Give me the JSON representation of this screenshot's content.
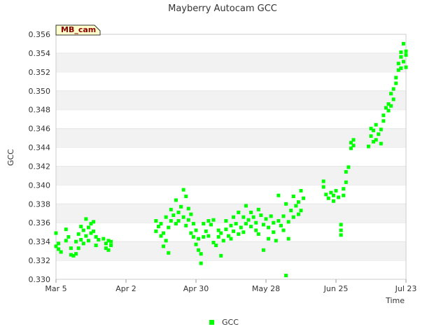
{
  "chart_data": {
    "type": "scatter",
    "title": "Mayberry Autocam GCC",
    "xlabel": "Time",
    "ylabel": "GCC",
    "badge": "MB_cam",
    "x_ticks": [
      "Mar 5",
      "Apr 2",
      "Apr 30",
      "May 28",
      "Jun 25",
      "Jul 23"
    ],
    "x_range": [
      "Mar 5",
      "Jul 23"
    ],
    "ylim": [
      0.33,
      0.356
    ],
    "y_ticks": [
      "0.330",
      "0.332",
      "0.334",
      "0.336",
      "0.338",
      "0.340",
      "0.342",
      "0.344",
      "0.346",
      "0.348",
      "0.350",
      "0.352",
      "0.354",
      "0.356"
    ],
    "grid": "horizontal alternating bands",
    "legend": {
      "position": "bottom",
      "entries": [
        "GCC"
      ]
    },
    "colors": {
      "series": "#00ff00",
      "band": "#f2f2f2",
      "badge_fill": "#ffffcc"
    },
    "series": [
      {
        "name": "GCC",
        "points": [
          [
            "Mar 5",
            0.3335
          ],
          [
            "Mar 5",
            0.3349
          ],
          [
            "Mar 6",
            0.3332
          ],
          [
            "Mar 6",
            0.3338
          ],
          [
            "Mar 7",
            0.3329
          ],
          [
            "Mar 9",
            0.3341
          ],
          [
            "Mar 9",
            0.3353
          ],
          [
            "Mar 10",
            0.3345
          ],
          [
            "Mar 11",
            0.3326
          ],
          [
            "Mar 11",
            0.3333
          ],
          [
            "Mar 12",
            0.3325
          ],
          [
            "Mar 13",
            0.334
          ],
          [
            "Mar 13",
            0.3327
          ],
          [
            "Mar 14",
            0.3348
          ],
          [
            "Mar 14",
            0.3333
          ],
          [
            "Mar 15",
            0.3356
          ],
          [
            "Mar 15",
            0.3342
          ],
          [
            "Mar 16",
            0.3338
          ],
          [
            "Mar 16",
            0.3352
          ],
          [
            "Mar 17",
            0.3364
          ],
          [
            "Mar 17",
            0.3346
          ],
          [
            "Mar 18",
            0.3355
          ],
          [
            "Mar 18",
            0.3341
          ],
          [
            "Mar 19",
            0.3359
          ],
          [
            "Mar 19",
            0.3349
          ],
          [
            "Mar 20",
            0.3351
          ],
          [
            "Mar 20",
            0.3361
          ],
          [
            "Mar 21",
            0.3345
          ],
          [
            "Mar 21",
            0.3336
          ],
          [
            "Mar 22",
            0.3342
          ],
          [
            "Mar 24",
            0.3343
          ],
          [
            "Mar 25",
            0.3338
          ],
          [
            "Mar 25",
            0.3333
          ],
          [
            "Mar 26",
            0.3341
          ],
          [
            "Mar 26",
            0.3331
          ],
          [
            "Mar 27",
            0.3336
          ],
          [
            "Mar 27",
            0.334
          ],
          [
            "Apr 14",
            0.3362
          ],
          [
            "Apr 14",
            0.3351
          ],
          [
            "Apr 15",
            0.3356
          ],
          [
            "Apr 16",
            0.3346
          ],
          [
            "Apr 16",
            0.3359
          ],
          [
            "Apr 17",
            0.3335
          ],
          [
            "Apr 17",
            0.3349
          ],
          [
            "Apr 18",
            0.3366
          ],
          [
            "Apr 18",
            0.3341
          ],
          [
            "Apr 19",
            0.3328
          ],
          [
            "Apr 19",
            0.3355
          ],
          [
            "Apr 20",
            0.3374
          ],
          [
            "Apr 20",
            0.3362
          ],
          [
            "Apr 21",
            0.3368
          ],
          [
            "Apr 22",
            0.3359
          ],
          [
            "Apr 22",
            0.3384
          ],
          [
            "Apr 23",
            0.3371
          ],
          [
            "Apr 23",
            0.3362
          ],
          [
            "Apr 24",
            0.3377
          ],
          [
            "Apr 25",
            0.3395
          ],
          [
            "Apr 25",
            0.3366
          ],
          [
            "Apr 26",
            0.3388
          ],
          [
            "Apr 26",
            0.3357
          ],
          [
            "Apr 27",
            0.3375
          ],
          [
            "Apr 27",
            0.3363
          ],
          [
            "Apr 28",
            0.3349
          ],
          [
            "Apr 28",
            0.3369
          ],
          [
            "Apr 29",
            0.3359
          ],
          [
            "Apr 29",
            0.3345
          ],
          [
            "Apr 30",
            0.3337
          ],
          [
            "Apr 30",
            0.3352
          ],
          [
            "May 1",
            0.3331
          ],
          [
            "May 1",
            0.3343
          ],
          [
            "May 2",
            0.3327
          ],
          [
            "May 2",
            0.3317
          ],
          [
            "May 3",
            0.3359
          ],
          [
            "May 3",
            0.3345
          ],
          [
            "May 4",
            0.3351
          ],
          [
            "May 5",
            0.3362
          ],
          [
            "May 5",
            0.3346
          ],
          [
            "May 6",
            0.3358
          ],
          [
            "May 7",
            0.3363
          ],
          [
            "May 7",
            0.3339
          ],
          [
            "May 8",
            0.3336
          ],
          [
            "May 9",
            0.3352
          ],
          [
            "May 9",
            0.3345
          ],
          [
            "May 10",
            0.3325
          ],
          [
            "May 10",
            0.3349
          ],
          [
            "May 11",
            0.3341
          ],
          [
            "May 12",
            0.3362
          ],
          [
            "May 12",
            0.3353
          ],
          [
            "May 13",
            0.3346
          ],
          [
            "May 14",
            0.3357
          ],
          [
            "May 14",
            0.3343
          ],
          [
            "May 15",
            0.3366
          ],
          [
            "May 15",
            0.3351
          ],
          [
            "May 16",
            0.3359
          ],
          [
            "May 17",
            0.3348
          ],
          [
            "May 17",
            0.3371
          ],
          [
            "May 18",
            0.3355
          ],
          [
            "May 19",
            0.3366
          ],
          [
            "May 19",
            0.335
          ],
          [
            "May 20",
            0.3378
          ],
          [
            "May 20",
            0.3359
          ],
          [
            "May 21",
            0.3363
          ],
          [
            "May 22",
            0.3356
          ],
          [
            "May 22",
            0.3371
          ],
          [
            "May 23",
            0.3366
          ],
          [
            "May 24",
            0.3352
          ],
          [
            "May 24",
            0.336
          ],
          [
            "May 25",
            0.3374
          ],
          [
            "May 25",
            0.3348
          ],
          [
            "May 26",
            0.3368
          ],
          [
            "May 27",
            0.3358
          ],
          [
            "May 27",
            0.3331
          ],
          [
            "May 28",
            0.3364
          ],
          [
            "May 29",
            0.3355
          ],
          [
            "May 29",
            0.3343
          ],
          [
            "May 30",
            0.3367
          ],
          [
            "May 31",
            0.335
          ],
          [
            "May 31",
            0.336
          ],
          [
            "Jun 1",
            0.3341
          ],
          [
            "Jun 2",
            0.3389
          ],
          [
            "Jun 2",
            0.3362
          ],
          [
            "Jun 3",
            0.3357
          ],
          [
            "Jun 4",
            0.3367
          ],
          [
            "Jun 4",
            0.3352
          ],
          [
            "Jun 5",
            0.338
          ],
          [
            "Jun 5",
            0.3304
          ],
          [
            "Jun 6",
            0.3361
          ],
          [
            "Jun 6",
            0.3343
          ],
          [
            "Jun 7",
            0.3373
          ],
          [
            "Jun 8",
            0.3388
          ],
          [
            "Jun 8",
            0.3366
          ],
          [
            "Jun 9",
            0.3378
          ],
          [
            "Jun 10",
            0.3369
          ],
          [
            "Jun 10",
            0.3382
          ],
          [
            "Jun 11",
            0.3394
          ],
          [
            "Jun 11",
            0.3373
          ],
          [
            "Jun 12",
            0.3386
          ],
          [
            "Jun 20",
            0.3404
          ],
          [
            "Jun 20",
            0.3398
          ],
          [
            "Jun 21",
            0.339
          ],
          [
            "Jun 22",
            0.3386
          ],
          [
            "Jun 23",
            0.3392
          ],
          [
            "Jun 24",
            0.3383
          ],
          [
            "Jun 24",
            0.3389
          ],
          [
            "Jun 25",
            0.3394
          ],
          [
            "Jun 26",
            0.3387
          ],
          [
            "Jun 27",
            0.3352
          ],
          [
            "Jun 27",
            0.3358
          ],
          [
            "Jun 27",
            0.3347
          ],
          [
            "Jun 28",
            0.3396
          ],
          [
            "Jun 28",
            0.3389
          ],
          [
            "Jun 29",
            0.3403
          ],
          [
            "Jun 29",
            0.3414
          ],
          [
            "Jun 30",
            0.3419
          ],
          [
            "Jul 1",
            0.3439
          ],
          [
            "Jul 1",
            0.3445
          ],
          [
            "Jul 2",
            0.3448
          ],
          [
            "Jul 2",
            0.3442
          ],
          [
            "Jul 8",
            0.3441
          ],
          [
            "Jul 9",
            0.3452
          ],
          [
            "Jul 9",
            0.346
          ],
          [
            "Jul 10",
            0.3446
          ],
          [
            "Jul 10",
            0.3458
          ],
          [
            "Jul 11",
            0.3448
          ],
          [
            "Jul 11",
            0.3464
          ],
          [
            "Jul 12",
            0.3454
          ],
          [
            "Jul 13",
            0.3459
          ],
          [
            "Jul 13",
            0.3444
          ],
          [
            "Jul 14",
            0.3468
          ],
          [
            "Jul 14",
            0.3474
          ],
          [
            "Jul 15",
            0.3482
          ],
          [
            "Jul 16",
            0.3486
          ],
          [
            "Jul 16",
            0.3479
          ],
          [
            "Jul 17",
            0.3497
          ],
          [
            "Jul 17",
            0.3484
          ],
          [
            "Jul 18",
            0.3491
          ],
          [
            "Jul 18",
            0.3502
          ],
          [
            "Jul 19",
            0.3508
          ],
          [
            "Jul 19",
            0.3514
          ],
          [
            "Jul 20",
            0.3522
          ],
          [
            "Jul 20",
            0.3529
          ],
          [
            "Jul 21",
            0.3536
          ],
          [
            "Jul 21",
            0.3541
          ],
          [
            "Jul 21",
            0.3524
          ],
          [
            "Jul 22",
            0.355
          ],
          [
            "Jul 22",
            0.3531
          ],
          [
            "Jul 23",
            0.3538
          ],
          [
            "Jul 23",
            0.3525
          ],
          [
            "Jul 23",
            0.3542
          ]
        ]
      }
    ]
  }
}
